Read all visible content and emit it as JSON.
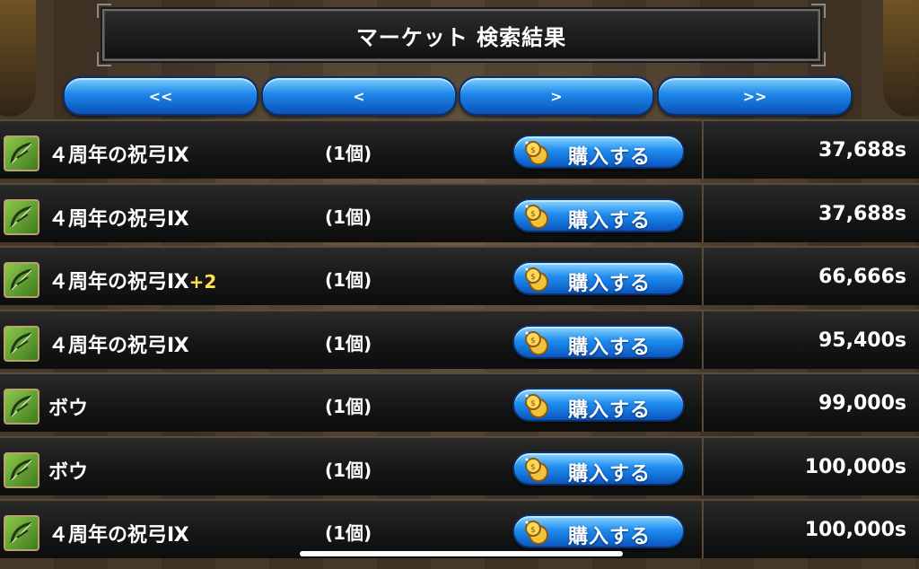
{
  "header": {
    "title": "マーケット 検索結果"
  },
  "nav": {
    "first_label": "<<",
    "prev_label": "<",
    "next_label": ">",
    "last_label": ">>"
  },
  "buy_label": "購入する",
  "colors": {
    "accent_blue": "#1d86e8",
    "plus_yellow": "#ffe24a",
    "item_icon_green": "#6aa83a"
  },
  "items": [
    {
      "icon": "bow-icon",
      "name": "４周年の祝弓Ⅸ",
      "plus": "",
      "qty": "(1個)",
      "price": "37,688s"
    },
    {
      "icon": "bow-icon",
      "name": "４周年の祝弓Ⅸ",
      "plus": "",
      "qty": "(1個)",
      "price": "37,688s"
    },
    {
      "icon": "bow-icon",
      "name": "４周年の祝弓Ⅸ",
      "plus": "+2",
      "qty": "(1個)",
      "price": "66,666s"
    },
    {
      "icon": "bow-icon",
      "name": "４周年の祝弓Ⅸ",
      "plus": "",
      "qty": "(1個)",
      "price": "95,400s"
    },
    {
      "icon": "bow-icon",
      "name": "ボウ",
      "plus": "",
      "qty": "(1個)",
      "price": "99,000s"
    },
    {
      "icon": "bow-icon",
      "name": "ボウ",
      "plus": "",
      "qty": "(1個)",
      "price": "100,000s"
    },
    {
      "icon": "bow-icon",
      "name": "４周年の祝弓Ⅸ",
      "plus": "",
      "qty": "(1個)",
      "price": "100,000s"
    }
  ]
}
